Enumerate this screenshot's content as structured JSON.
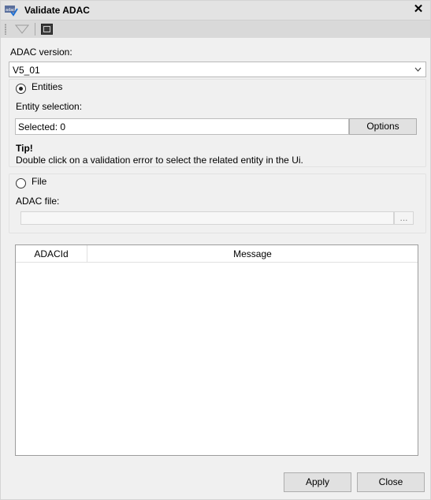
{
  "window": {
    "title": "Validate ADAC",
    "close_label": "✕"
  },
  "toolbar": {
    "filter_icon": "filter-icon",
    "window_icon": "window-icon"
  },
  "adac_version": {
    "label": "ADAC version:",
    "selected": "V5_01"
  },
  "entities": {
    "radio_label": "Entities",
    "selected": true,
    "selection_label": "Entity selection:",
    "selection_value": "Selected: 0",
    "options_button": "Options",
    "tip_title": "Tip!",
    "tip_text": "Double click on a validation error to select the related entity in the Ui."
  },
  "file": {
    "radio_label": "File",
    "selected": false,
    "file_label": "ADAC file:",
    "file_value": "",
    "browse_button": "..."
  },
  "results_table": {
    "columns": [
      "ADACId",
      "Message"
    ],
    "rows": []
  },
  "footer": {
    "apply_button": "Apply",
    "close_button": "Close"
  }
}
